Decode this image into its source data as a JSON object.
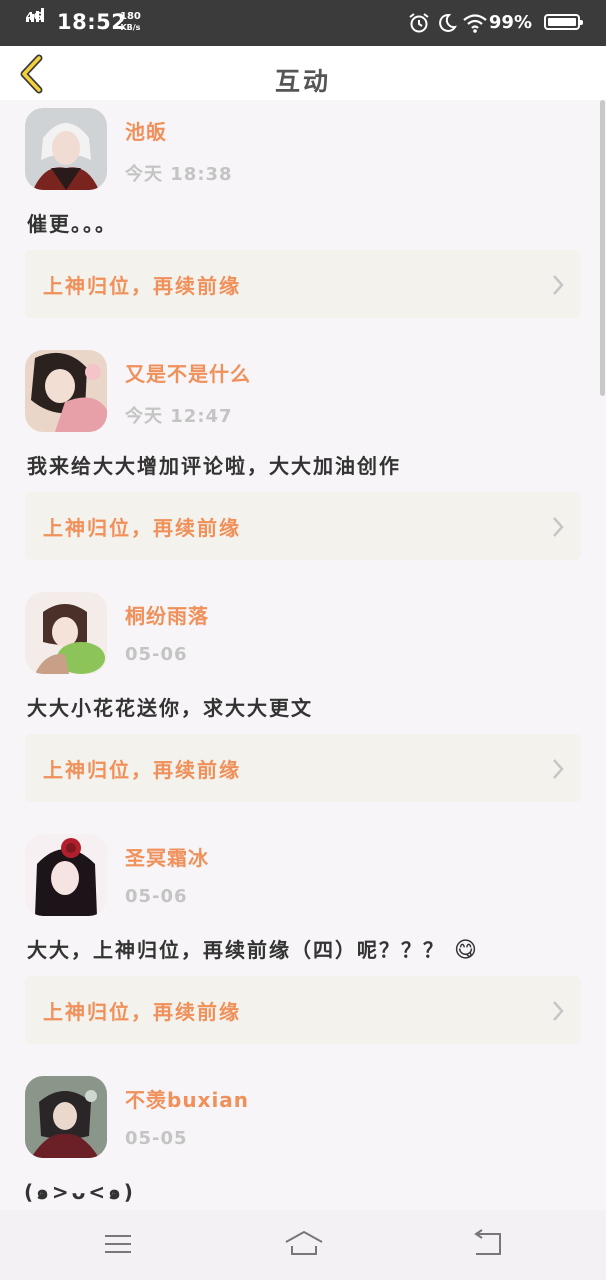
{
  "status_bar": {
    "network": "4G",
    "time": "18:52",
    "speed_value": "180",
    "speed_unit": "KB/s",
    "icons": [
      "alarm-icon",
      "moon-icon",
      "wifi-icon"
    ],
    "battery_percent": "99%",
    "battery_level": 0.99
  },
  "header": {
    "back_icon": "back-chevron-icon",
    "title": "互动"
  },
  "feed": {
    "items": [
      {
        "username": "池皈",
        "time": "今天 18:38",
        "comment": "催更。。。",
        "work_title": "上神归位，再续前缘"
      },
      {
        "username": "又是不是什么",
        "time": "今天 12:47",
        "comment": "我来给大大增加评论啦，大大加油创作",
        "work_title": "上神归位，再续前缘"
      },
      {
        "username": "桐纷雨落",
        "time": "05-06",
        "comment": "大大小花花送你，求大大更文",
        "work_title": "上神归位，再续前缘"
      },
      {
        "username": "圣冥霜冰",
        "time": "05-06",
        "comment": "大大，上神归位，再续前缘（四）呢？？？",
        "comment_emoji": "😋",
        "work_title": "上神归位，再续前缘"
      },
      {
        "username": "不羡buxian",
        "time": "05-05",
        "comment": "(๑>ᴗ<๑)"
      }
    ]
  },
  "nav_bar": {
    "icons": [
      "menu-icon",
      "home-icon",
      "back-icon"
    ]
  },
  "colors": {
    "accent": "#f0905a",
    "status_bar_bg": "#3b3b3b",
    "page_bg": "#f7f5f7",
    "card_bg": "#f4f2ec"
  }
}
